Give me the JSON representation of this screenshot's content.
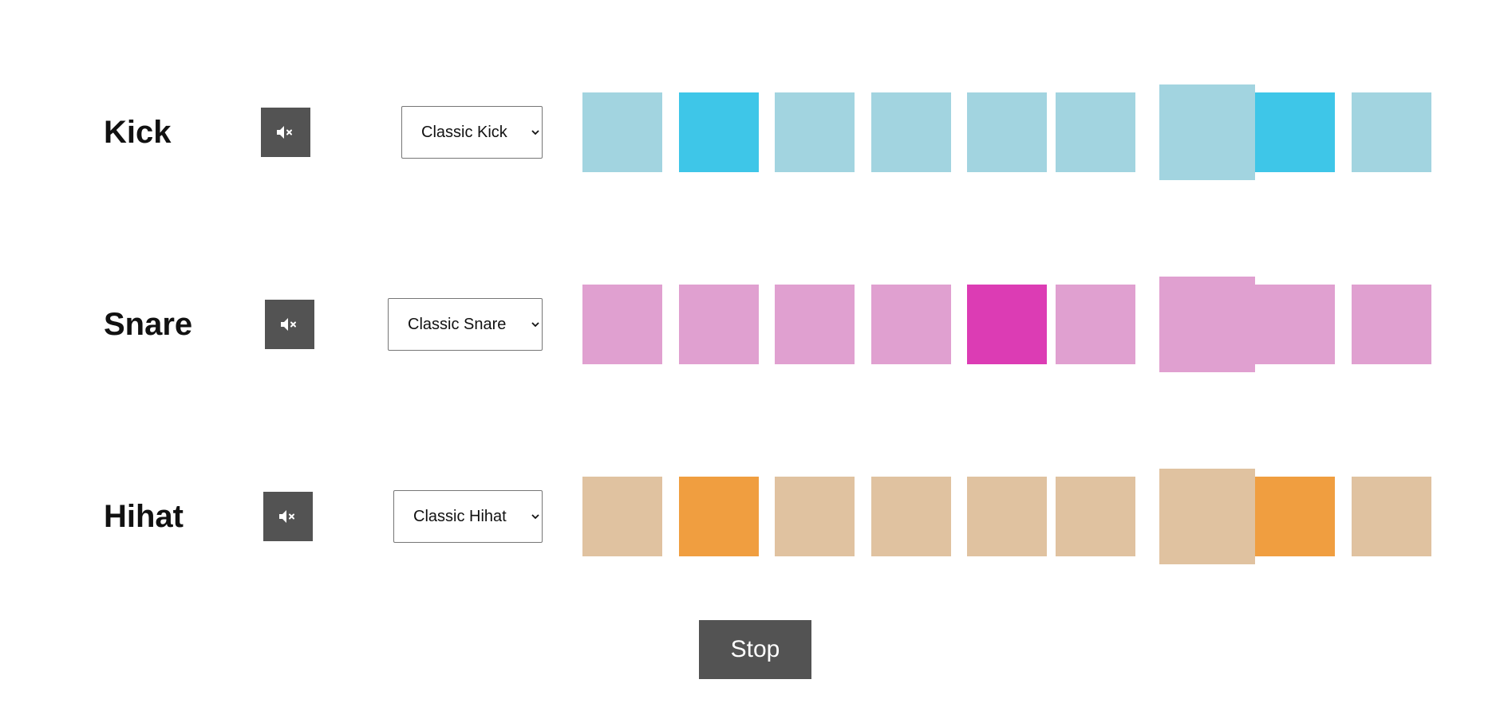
{
  "tracks": [
    {
      "name": "Kick",
      "mute_icon": "volume-mute-icon",
      "sound": "Classic Kick",
      "pad_color": "#a2d4e0",
      "active_color": "#3ec6e8",
      "pads": [
        false,
        true,
        false,
        false,
        false,
        false,
        false,
        true,
        false
      ]
    },
    {
      "name": "Snare",
      "mute_icon": "volume-mute-icon",
      "sound": "Classic Snare",
      "pad_color": "#e0a0d0",
      "active_color": "#dc3cb4",
      "pads": [
        false,
        false,
        false,
        false,
        true,
        false,
        false,
        false,
        false
      ]
    },
    {
      "name": "Hihat",
      "mute_icon": "volume-mute-icon",
      "sound": "Classic Hihat",
      "pad_color": "#e0c2a0",
      "active_color": "#f09e40",
      "pads": [
        false,
        true,
        false,
        false,
        false,
        false,
        false,
        true,
        false
      ]
    }
  ],
  "current_step": 6,
  "stop_label": "Stop"
}
